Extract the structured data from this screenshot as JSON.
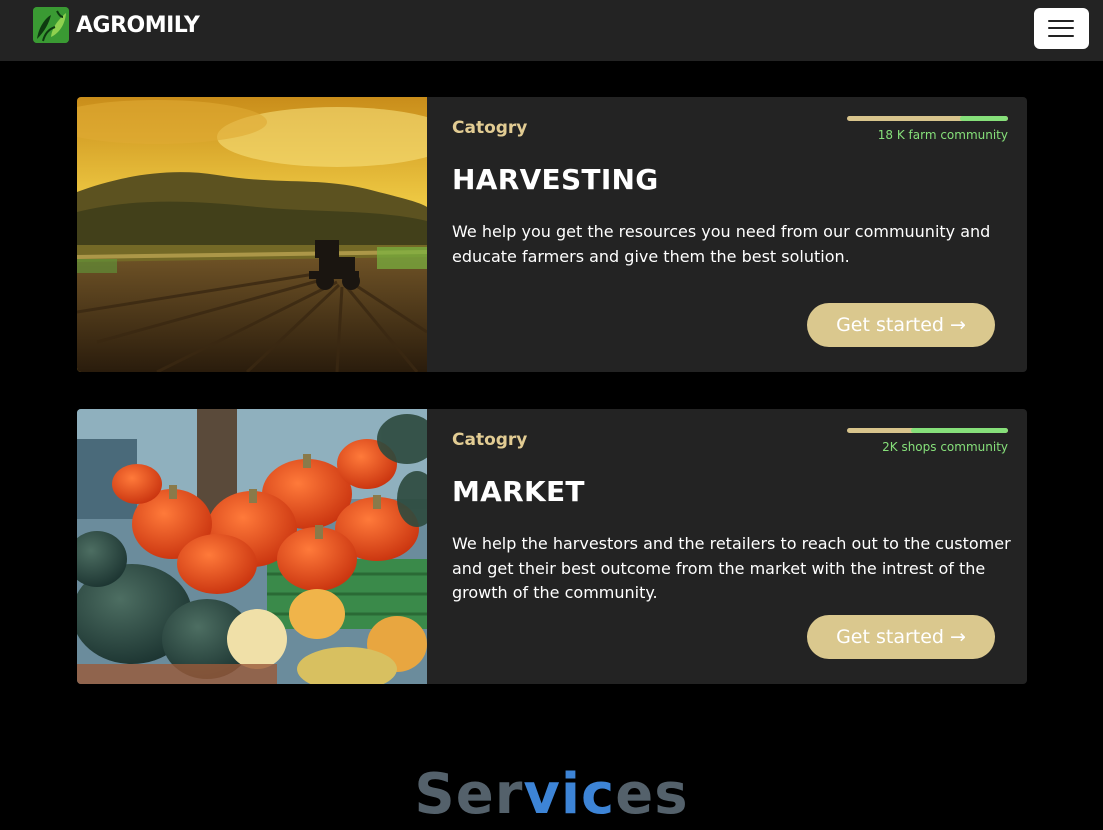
{
  "navbar": {
    "brand_name": "AGROMILY",
    "logo_icon": "leaf-logo-icon",
    "menu_icon": "hamburger-menu-icon"
  },
  "cards": [
    {
      "category": "Catogry",
      "community": "18 K farm community",
      "community_progress": 0.7,
      "title": "HARVESTING",
      "description": "We help you get the resources you need from our commuunity and educate farmers and give them the best solution.",
      "cta": "Get started →",
      "image": "tractor-field-photo"
    },
    {
      "category": "Catogry",
      "community": "2K shops community",
      "community_progress": 0.6,
      "title": "MARKET",
      "description": "We help the harvestors and the retailers to reach out to the customer and get their best outcome from the market with the intrest of the growth of the community.",
      "cta": "Get started →",
      "image": "pumpkin-market-photo"
    }
  ],
  "services": {
    "title_prefix": "Ser",
    "title_highlight": "vic",
    "title_suffix": "es"
  },
  "colors": {
    "accent_gold": "#dac88e",
    "accent_green": "#86e07a",
    "highlight_blue": "#3d84d6",
    "card_bg": "#232323"
  }
}
